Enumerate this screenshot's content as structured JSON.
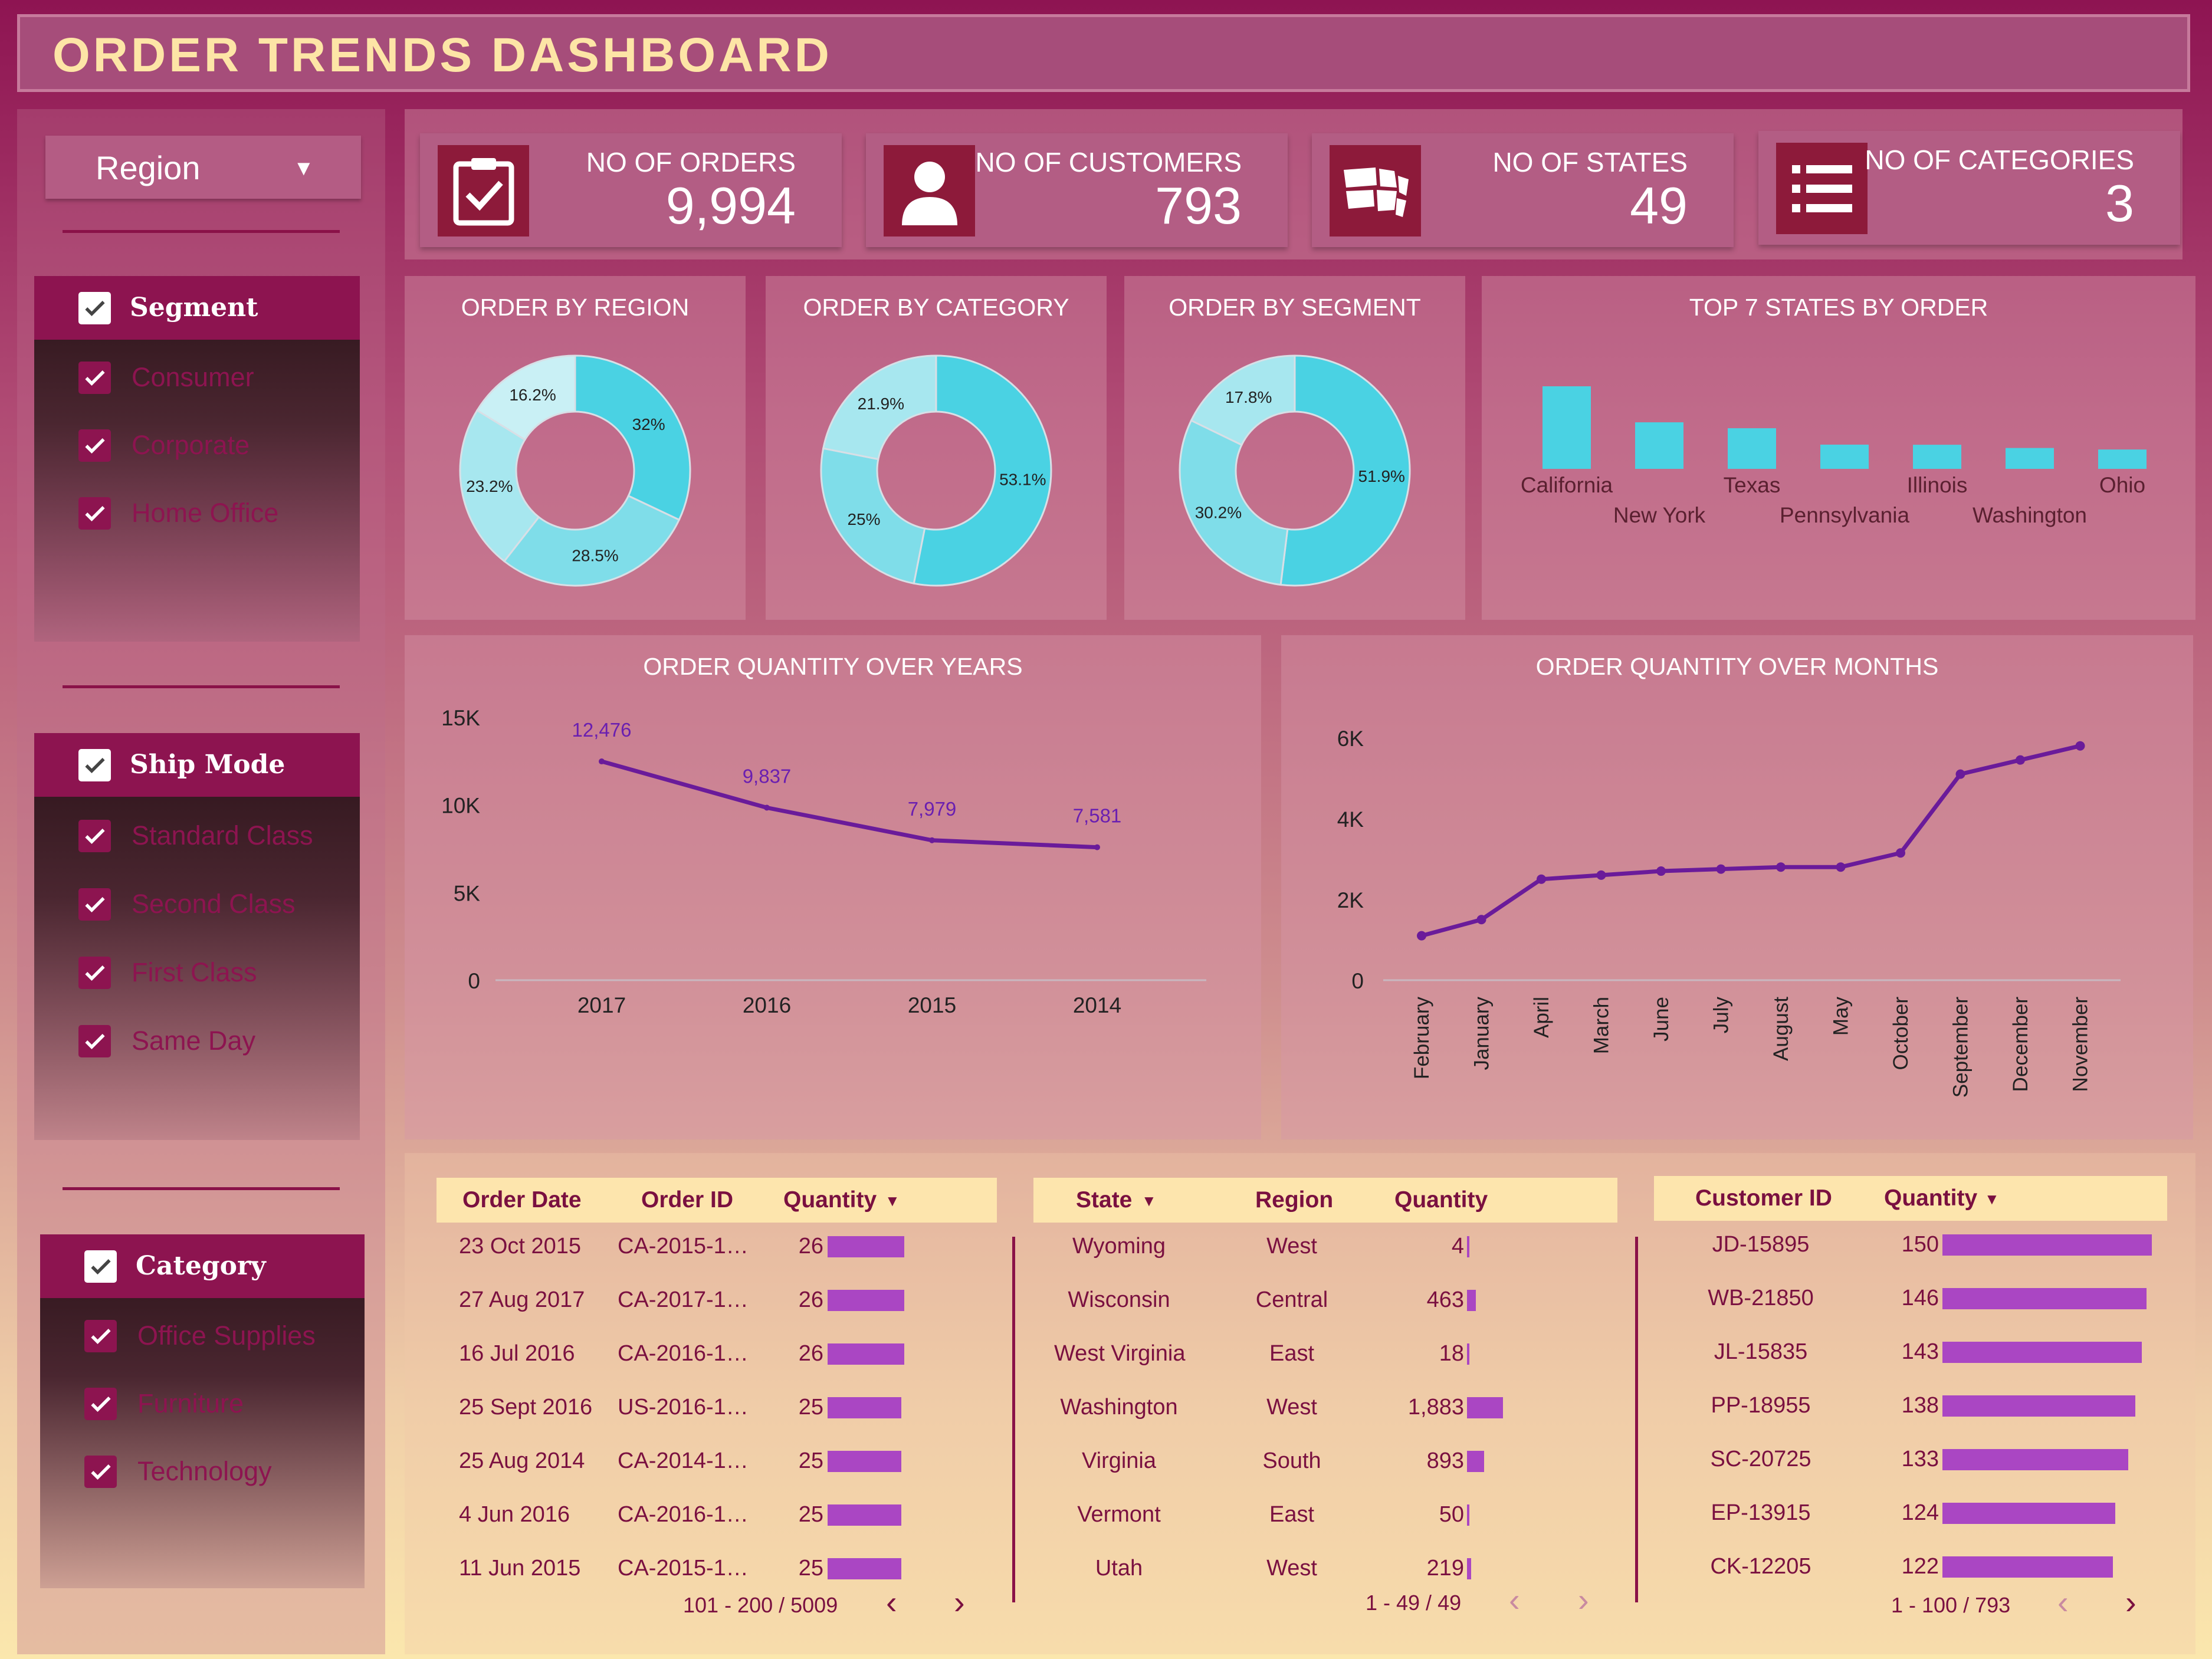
{
  "header": {
    "title": "ORDER  TRENDS  DASHBOARD"
  },
  "sidebar": {
    "dropdown": {
      "label": "Region"
    },
    "segment": {
      "title": "Segment",
      "items": [
        "Consumer",
        "Corporate",
        "Home Office"
      ]
    },
    "ship_mode": {
      "title": "Ship Mode",
      "items": [
        "Standard Class",
        "Second Class",
        "First Class",
        "Same Day"
      ]
    },
    "category": {
      "title": "Category",
      "items": [
        "Office Supplies",
        "Furniture",
        "Technology"
      ]
    }
  },
  "kpis": [
    {
      "label": "NO OF ORDERS",
      "value": "9,994",
      "icon": "clipboard-check-icon"
    },
    {
      "label": "NO OF CUSTOMERS",
      "value": "793",
      "icon": "user-icon"
    },
    {
      "label": "NO OF STATES",
      "value": "49",
      "icon": "map-icon"
    },
    {
      "label": "NO OF CATEGORIES",
      "value": "3",
      "icon": "list-icon"
    }
  ],
  "colors": {
    "donut": [
      "#4ad2e3",
      "#7fdde9",
      "#a7e7ef",
      "#c9f0f5"
    ],
    "bar": "#4ad2e3",
    "line": "#6a1b9a",
    "table_bar": "#aa46c3",
    "accent": "#8d1450"
  },
  "chart_data": [
    {
      "type": "pie",
      "title": "ORDER BY REGION",
      "slices": [
        {
          "label": "32%",
          "value": 32
        },
        {
          "label": "28.5%",
          "value": 28.5
        },
        {
          "label": "23.2%",
          "value": 23.2
        },
        {
          "label": "16.2%",
          "value": 16.2
        }
      ]
    },
    {
      "type": "pie",
      "title": "ORDER BY CATEGORY",
      "slices": [
        {
          "label": "53.1%",
          "value": 53.1
        },
        {
          "label": "25%",
          "value": 25
        },
        {
          "label": "21.9%",
          "value": 21.9
        }
      ]
    },
    {
      "type": "pie",
      "title": "ORDER BY SEGMENT",
      "slices": [
        {
          "label": "51.9%",
          "value": 51.9
        },
        {
          "label": "30.2%",
          "value": 30.2
        },
        {
          "label": "17.8%",
          "value": 17.8
        }
      ]
    },
    {
      "type": "bar",
      "title": "TOP 7 STATES BY ORDER",
      "categories": [
        "California",
        "New York",
        "Texas",
        "Pennsylvania",
        "Illinois",
        "Washington",
        "Ohio"
      ],
      "values": [
        2001,
        1128,
        985,
        587,
        584,
        506,
        469
      ]
    },
    {
      "type": "line",
      "title": "ORDER QUANTITY OVER YEARS",
      "categories": [
        "2017",
        "2016",
        "2015",
        "2014"
      ],
      "values": [
        12476,
        9837,
        7979,
        7581
      ],
      "data_labels": [
        "12,476",
        "9,837",
        "7,979",
        "7,581"
      ],
      "y_ticks": [
        "0",
        "5K",
        "10K",
        "15K"
      ],
      "ylim": [
        0,
        15000
      ]
    },
    {
      "type": "line",
      "title": "ORDER QUANTITY OVER MONTHS",
      "categories": [
        "February",
        "January",
        "April",
        "March",
        "June",
        "July",
        "August",
        "May",
        "October",
        "September",
        "December",
        "November"
      ],
      "values": [
        1100,
        1500,
        2500,
        2600,
        2700,
        2750,
        2800,
        2800,
        3150,
        5100,
        5450,
        5800
      ],
      "y_ticks": [
        "0",
        "2K",
        "4K",
        "6K"
      ],
      "ylim": [
        0,
        6000
      ]
    }
  ],
  "tables": {
    "orders": {
      "headers": [
        "Order Date",
        "Order ID",
        "Quantity"
      ],
      "rows": [
        [
          "23 Oct 2015",
          "CA-2015-1…",
          "26"
        ],
        [
          "27 Aug 2017",
          "CA-2017-1…",
          "26"
        ],
        [
          "16 Jul 2016",
          "CA-2016-1…",
          "26"
        ],
        [
          "25 Sept 2016",
          "US-2016-1…",
          "25"
        ],
        [
          "25 Aug 2014",
          "CA-2014-1…",
          "25"
        ],
        [
          "4 Jun 2016",
          "CA-2016-1…",
          "25"
        ],
        [
          "11 Jun 2015",
          "CA-2015-1…",
          "25"
        ]
      ],
      "quantities": [
        26,
        26,
        26,
        25,
        25,
        25,
        25
      ],
      "max": 26,
      "pager": "101 - 200 / 5009"
    },
    "states": {
      "headers": [
        "State",
        "Region",
        "Quantity"
      ],
      "rows": [
        [
          "Wyoming",
          "West",
          "4"
        ],
        [
          "Wisconsin",
          "Central",
          "463"
        ],
        [
          "West Virginia",
          "East",
          "18"
        ],
        [
          "Washington",
          "West",
          "1,883"
        ],
        [
          "Virginia",
          "South",
          "893"
        ],
        [
          "Vermont",
          "East",
          "50"
        ],
        [
          "Utah",
          "West",
          "219"
        ]
      ],
      "quantities": [
        4,
        463,
        18,
        1883,
        893,
        50,
        219
      ],
      "max": 7667,
      "pager": "1 - 49 / 49"
    },
    "customers": {
      "headers": [
        "Customer ID",
        "Quantity"
      ],
      "rows": [
        [
          "JD-15895",
          "150"
        ],
        [
          "WB-21850",
          "146"
        ],
        [
          "JL-15835",
          "143"
        ],
        [
          "PP-18955",
          "138"
        ],
        [
          "SC-20725",
          "133"
        ],
        [
          "EP-13915",
          "124"
        ],
        [
          "CK-12205",
          "122"
        ]
      ],
      "quantities": [
        150,
        146,
        143,
        138,
        133,
        124,
        122
      ],
      "max": 150,
      "pager": "1 - 100 / 793"
    }
  }
}
